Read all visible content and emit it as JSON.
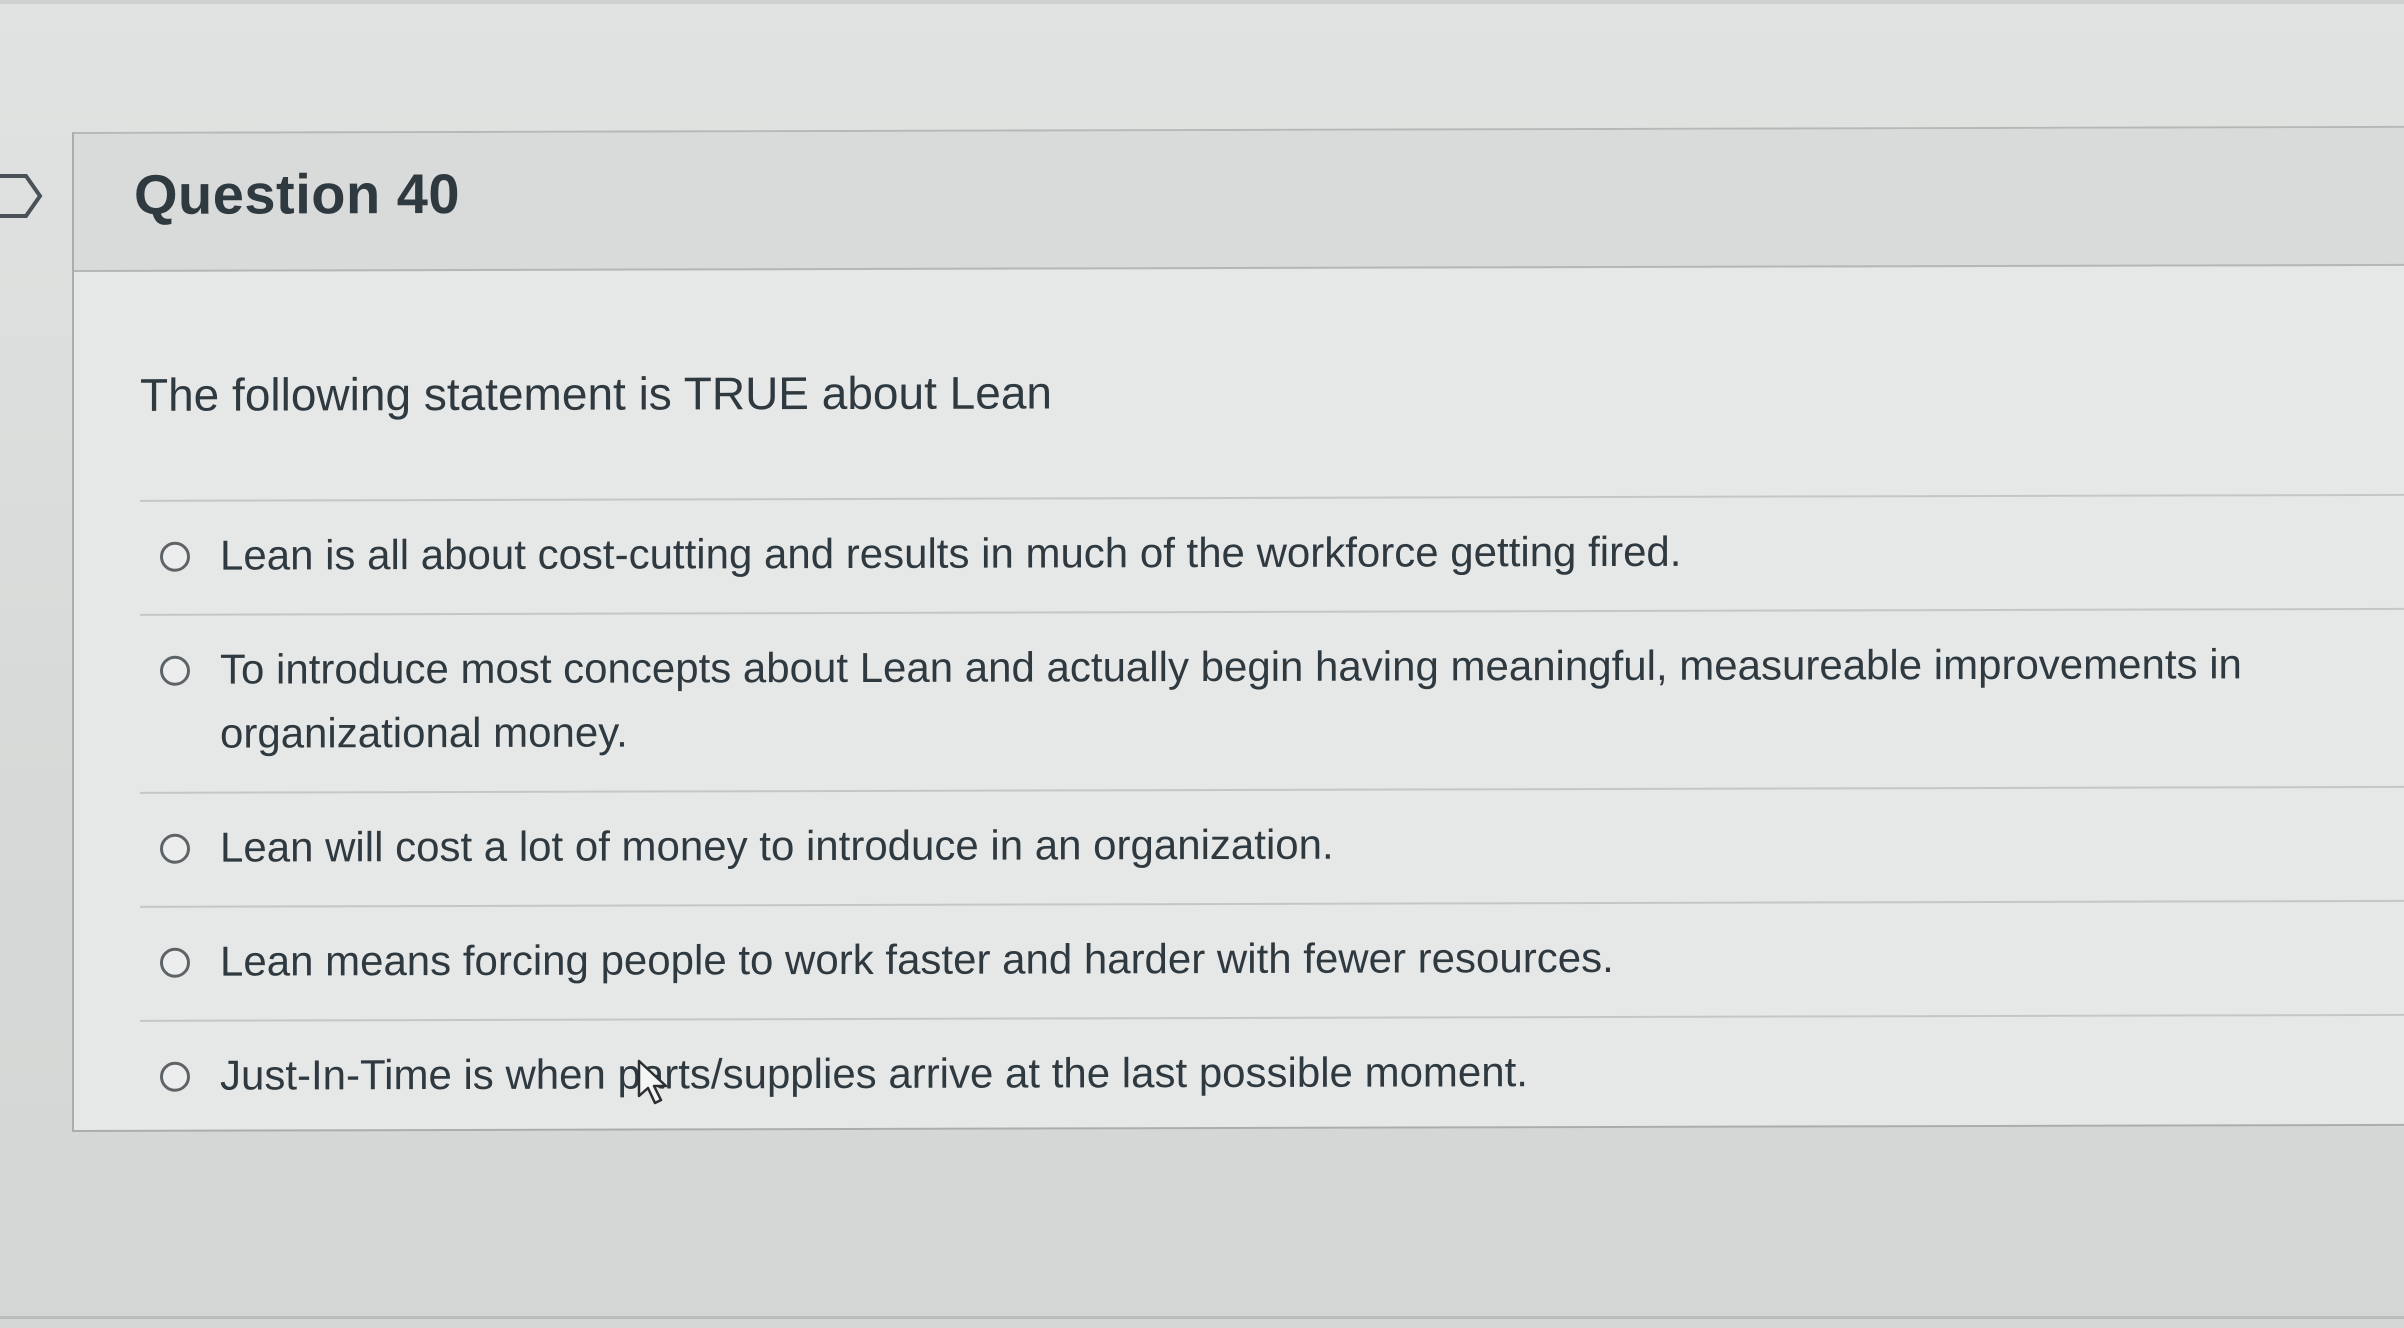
{
  "question": {
    "title": "Question 40",
    "prompt": "The following statement is TRUE about Lean",
    "answers": [
      {
        "label": "Lean is all about cost-cutting and results in much of the workforce getting fired.",
        "selected": false
      },
      {
        "label": "To introduce most concepts about Lean and actually begin having meaningful, measureable improvements in organizational money.",
        "selected": false
      },
      {
        "label": "Lean will cost a lot of money to introduce in an organization.",
        "selected": false
      },
      {
        "label": "Lean means forcing people to work faster and harder with fewer resources.",
        "selected": false
      },
      {
        "label": "Just-In-Time is when parts/supplies arrive at the last possible moment.",
        "selected": false
      }
    ]
  },
  "icons": {
    "flag": "flag-icon",
    "radio": "radio-button-icon",
    "cursor": "mouse-pointer-icon"
  },
  "colors": {
    "text": "#2f3940",
    "background": "#dcdedd",
    "card": "#e6e8e7",
    "header": "#d9dbda",
    "divider": "#c3c7c6"
  }
}
